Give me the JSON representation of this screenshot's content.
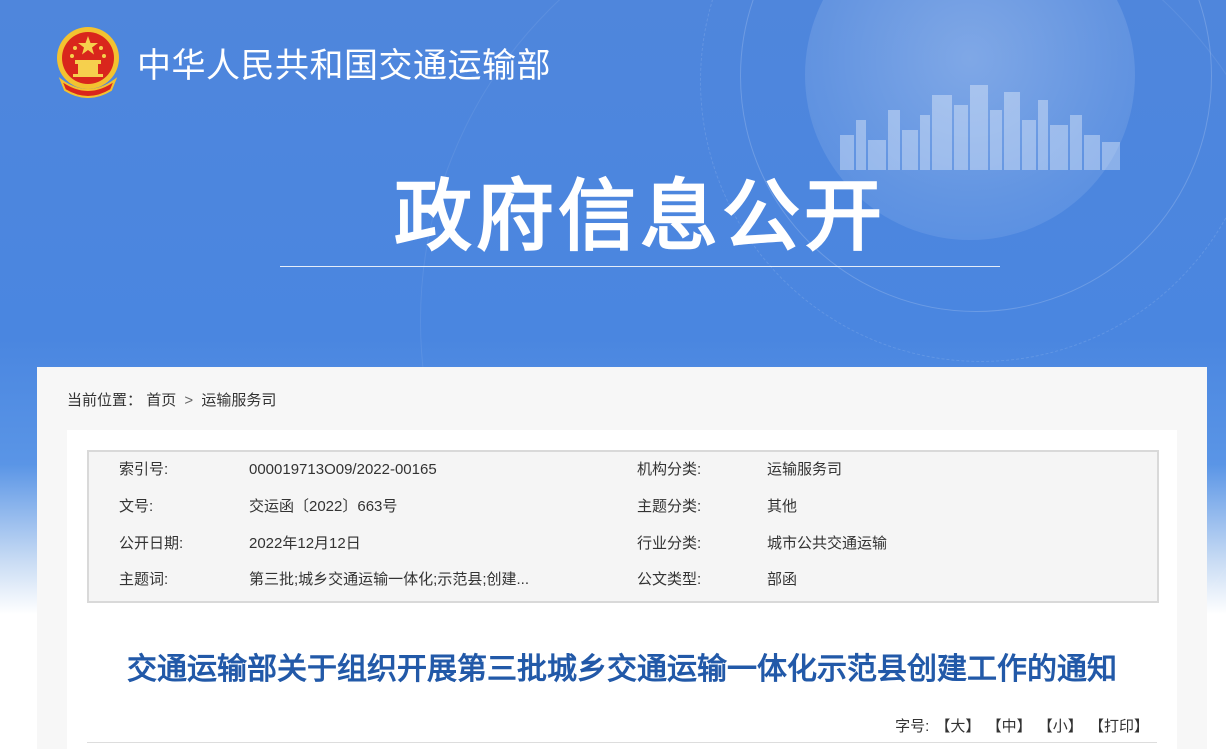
{
  "header": {
    "site_name": "中华人民共和国交通运输部",
    "page_heading": "政府信息公开",
    "logo_icon": "national-emblem-icon"
  },
  "colors": {
    "banner_blue": "#4a86e0",
    "title_blue": "#2259a8"
  },
  "breadcrumb": {
    "label": "当前位置：",
    "items": [
      "首页",
      "运输服务司"
    ],
    "separator": ">"
  },
  "meta": {
    "rows": [
      {
        "k1": "索引号:",
        "v1": "000019713O09/2022-00165",
        "k2": "机构分类:",
        "v2": "运输服务司"
      },
      {
        "k1": "文号:",
        "v1": "交运函〔2022〕663号",
        "k2": "主题分类:",
        "v2": "其他"
      },
      {
        "k1": "公开日期:",
        "v1": "2022年12月12日",
        "k2": "行业分类:",
        "v2": "城市公共交通运输"
      },
      {
        "k1": "主题词:",
        "v1": "第三批;城乡交通运输一体化;示范县;创建...",
        "k2": "公文类型:",
        "v2": "部函"
      }
    ]
  },
  "article": {
    "title": "交通运输部关于组织开展第三批城乡交通运输一体化示范县创建工作的通知"
  },
  "font_tools": {
    "label": "字号:",
    "large": "【大】",
    "medium": "【中】",
    "small": "【小】",
    "print": "【打印】"
  }
}
